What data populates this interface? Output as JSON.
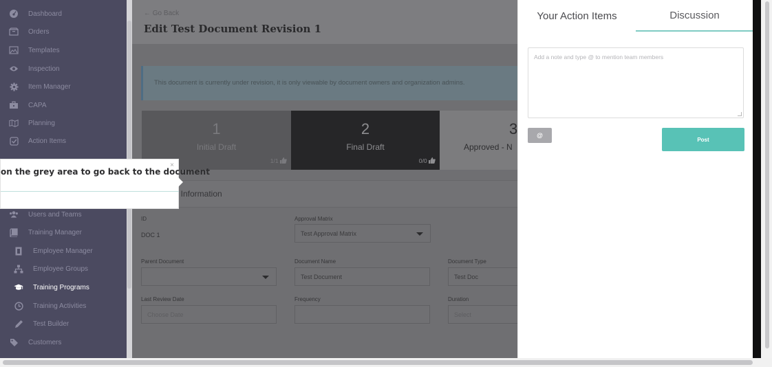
{
  "sidebar": {
    "items": [
      {
        "label": "Dashboard",
        "icon": "dashboard-icon"
      },
      {
        "label": "Orders",
        "icon": "orders-icon"
      },
      {
        "label": "Templates",
        "icon": "templates-icon"
      },
      {
        "label": "Inspection",
        "icon": "eye-icon"
      },
      {
        "label": "Item Manager",
        "icon": "gear-icon"
      },
      {
        "label": "CAPA",
        "icon": "briefcase-icon"
      },
      {
        "label": "Planning",
        "icon": "map-icon"
      },
      {
        "label": "Action Items",
        "icon": "checkbox-icon"
      },
      {
        "label": "Users and Teams",
        "icon": "users-icon"
      },
      {
        "label": "Training Manager",
        "icon": "book-icon"
      },
      {
        "label": "Employee Manager",
        "icon": "id-card-icon"
      },
      {
        "label": "Employee Groups",
        "icon": "sitemap-icon"
      },
      {
        "label": "Training Programs",
        "icon": "graduation-cap-icon"
      },
      {
        "label": "Training Activities",
        "icon": "clock-icon"
      },
      {
        "label": "Test Builder",
        "icon": "pencil-icon"
      },
      {
        "label": "Customers",
        "icon": "tag-icon"
      }
    ]
  },
  "page": {
    "go_back": "← Go Back",
    "title": "Edit Test Document Revision 1",
    "notice": "This document is currently under revision, it is only viewable by document owners and organization admins."
  },
  "stages": [
    {
      "number": "1",
      "name": "Initial Draft",
      "likes": "1/1"
    },
    {
      "number": "2",
      "name": "Final Draft",
      "likes": "0/0"
    },
    {
      "number": "3",
      "name": "Approved - N"
    }
  ],
  "section": {
    "title": "t Information"
  },
  "fields": {
    "id_label": "ID",
    "id_value": "DOC 1",
    "approval_matrix_label": "Approval Matrix",
    "approval_matrix_value": "Test Approval Matrix",
    "parent_document_label": "Parent Document",
    "parent_document_value": "",
    "document_name_label": "Document Name",
    "document_name_value": "Test Document",
    "document_type_label": "Document Type",
    "document_type_value": "Test Doc",
    "last_review_label": "Last Review Date",
    "last_review_placeholder": "Choose Date",
    "frequency_label": "Frequency",
    "frequency_value": "",
    "duration_label": "Duration",
    "duration_placeholder": "Select"
  },
  "tooltip": {
    "text": "on the grey area to go back to the document",
    "close": "×"
  },
  "panel": {
    "tab_action_items": "Your Action Items",
    "tab_discussion": "Discussion",
    "note_placeholder": "Add a note and type @ to mention team members",
    "at_button": "@",
    "post_button": "Post"
  },
  "colors": {
    "sidebar_bg": "#4b4a60",
    "accent": "#58c2b6",
    "overlay_dim": "#6f6f72"
  }
}
